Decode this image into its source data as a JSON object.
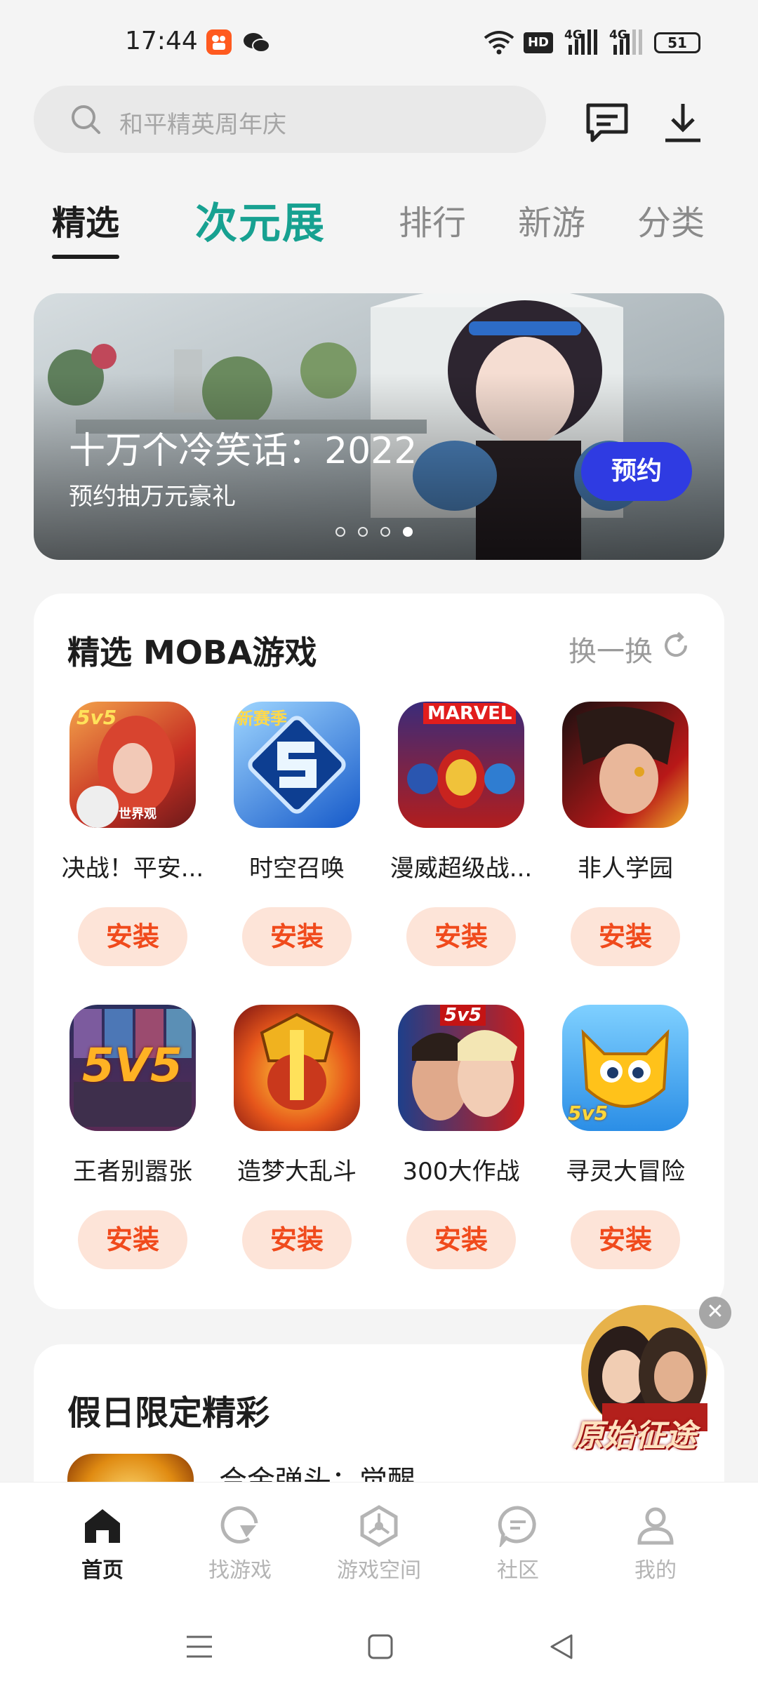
{
  "status_bar": {
    "time": "17:44",
    "hd_label": "HD",
    "network_1": "4G",
    "network_2": "4G",
    "battery": "51"
  },
  "search": {
    "placeholder": "和平精英周年庆"
  },
  "tabs": [
    {
      "label": "精选"
    },
    {
      "label": "次元展"
    },
    {
      "label": "排行"
    },
    {
      "label": "新游"
    },
    {
      "label": "分类"
    }
  ],
  "banner": {
    "title": "十万个冷笑话：2022",
    "subtitle": "预约抽万元豪礼",
    "button": "预约",
    "pages": 4,
    "current_page": 4
  },
  "moba_section": {
    "title": "精选 MOBA游戏",
    "refresh_label": "换一换",
    "apps": [
      {
        "name": "决战！平安...",
        "button": "安装",
        "icon_text": "5v5",
        "icon_sub": "世界观"
      },
      {
        "name": "时空召唤",
        "button": "安装",
        "icon_text": "新赛季"
      },
      {
        "name": "漫威超级战...",
        "button": "安装",
        "icon_text": "MARVEL"
      },
      {
        "name": "非人学园",
        "button": "安装"
      },
      {
        "name": "王者别嚣张",
        "button": "安装",
        "icon_text": "5V5"
      },
      {
        "name": "造梦大乱斗",
        "button": "安装"
      },
      {
        "name": "300大作战",
        "button": "安装",
        "icon_text": "5v5"
      },
      {
        "name": "寻灵大冒险",
        "button": "安装",
        "icon_text": "5v5"
      }
    ]
  },
  "holiday_section": {
    "title": "假日限定精彩",
    "first_app": "合金弹头：觉醒"
  },
  "floating_ad": {
    "text": "原始征途",
    "close": "✕"
  },
  "bottom_nav": [
    {
      "label": "首页",
      "icon": "home-icon"
    },
    {
      "label": "找游戏",
      "icon": "find-game-icon"
    },
    {
      "label": "游戏空间",
      "icon": "game-space-icon"
    },
    {
      "label": "社区",
      "icon": "community-icon"
    },
    {
      "label": "我的",
      "icon": "profile-icon"
    }
  ]
}
